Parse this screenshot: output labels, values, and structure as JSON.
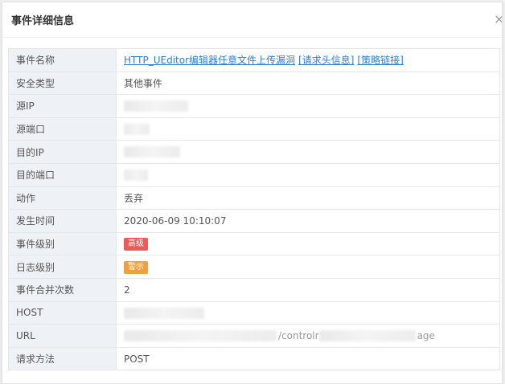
{
  "dialog": {
    "title": "事件详细信息",
    "close_icon": "close-icon"
  },
  "event": {
    "name_label": "事件名称",
    "name_link": "HTTP_UEditor编辑器任意文件上传漏洞",
    "request_header_link": "[请求头信息]",
    "policy_link": "[策略链接]",
    "security_type_label": "安全类型",
    "security_type_value": "其他事件",
    "src_ip_label": "源IP",
    "src_port_label": "源端口",
    "dst_ip_label": "目的IP",
    "dst_port_label": "目的端口",
    "action_label": "动作",
    "action_value": "丢弃",
    "time_label": "发生时间",
    "time_value": "2020-06-09 10:10:07",
    "event_level_label": "事件级别",
    "event_level_value": "高级",
    "log_level_label": "日志级别",
    "log_level_value": "警示",
    "merge_count_label": "事件合并次数",
    "merge_count_value": "2",
    "host_label": "HOST",
    "url_label": "URL",
    "url_visible_mid": "/controlr",
    "url_visible_tail": "age",
    "method_label": "请求方法",
    "method_value": "POST"
  },
  "colors": {
    "link": "#2f7fd0",
    "badge_high": "#ee5a5a",
    "badge_warn": "#f0a040",
    "label_bg": "#eef1f6"
  }
}
